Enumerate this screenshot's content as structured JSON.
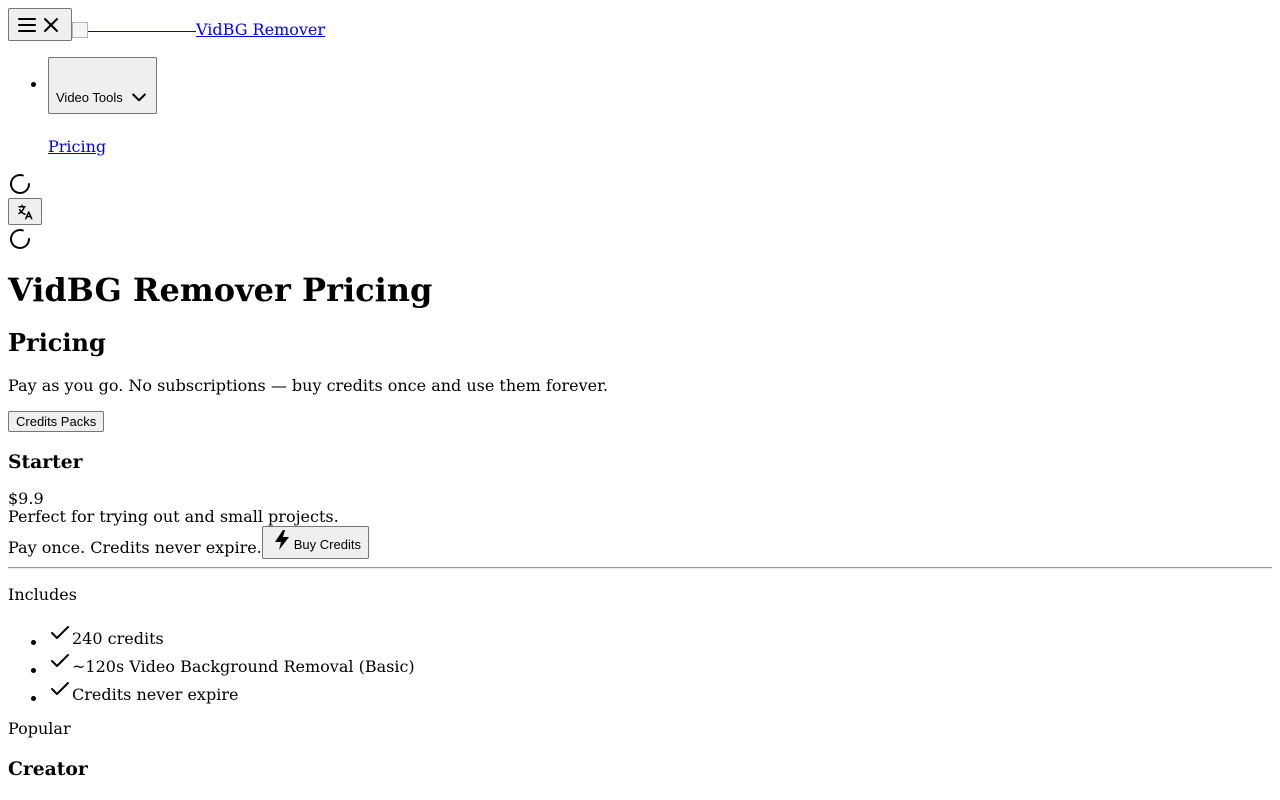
{
  "header": {
    "brand": "VidBG Remover",
    "menu_icon": "menu-icon",
    "close_icon": "close-icon"
  },
  "nav": {
    "video_tools_label": "Video Tools",
    "pricing_label": "Pricing"
  },
  "page": {
    "title": "VidBG Remover Pricing",
    "section_title": "Pricing",
    "subtitle": "Pay as you go. No subscriptions — buy credits once and use them forever.",
    "tab_label": "Credits Packs"
  },
  "plans": [
    {
      "name": "Starter",
      "price": "$9.9",
      "description": "Perfect for trying out and small projects.",
      "pay_note": "Pay once. Credits never expire.",
      "buy_label": "Buy Credits",
      "includes_label": "Includes",
      "features": [
        "240 credits",
        "~120s Video Background Removal (Basic)",
        "Credits never expire"
      ]
    },
    {
      "badge": "Popular",
      "name": "Creator"
    }
  ]
}
